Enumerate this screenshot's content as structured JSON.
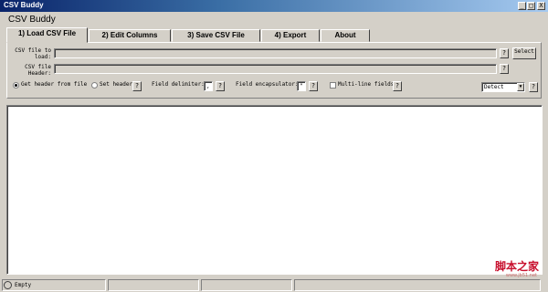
{
  "window": {
    "title": "CSV Buddy",
    "controls": [
      "_",
      "□",
      "X"
    ]
  },
  "app_title": "CSV Buddy",
  "tabs": [
    {
      "label": "1) Load CSV File",
      "active": true
    },
    {
      "label": "2) Edit Columns",
      "active": false
    },
    {
      "label": "3) Save CSV File",
      "active": false
    },
    {
      "label": "4) Export",
      "active": false
    },
    {
      "label": "About",
      "active": false
    }
  ],
  "load": {
    "csv_file_label": "CSV file to load:",
    "csv_file_value": "",
    "select_button": "Select",
    "header_label": "CSV file Header:",
    "header_value": "",
    "help": "?",
    "radio_get_header": "Get header from file",
    "radio_set_header": "Set header",
    "field_delimiter_label": "Field delimiter:",
    "field_delimiter_value": ",",
    "field_encapsulator_label": "Field encapsulator:",
    "field_encapsulator_value": "\"",
    "multiline_label": "Multi-line fields",
    "encoding_value": "Detect"
  },
  "status": {
    "text": "Empty"
  },
  "watermark": {
    "main": "脚本之家",
    "sub": "www.jb51.net"
  }
}
